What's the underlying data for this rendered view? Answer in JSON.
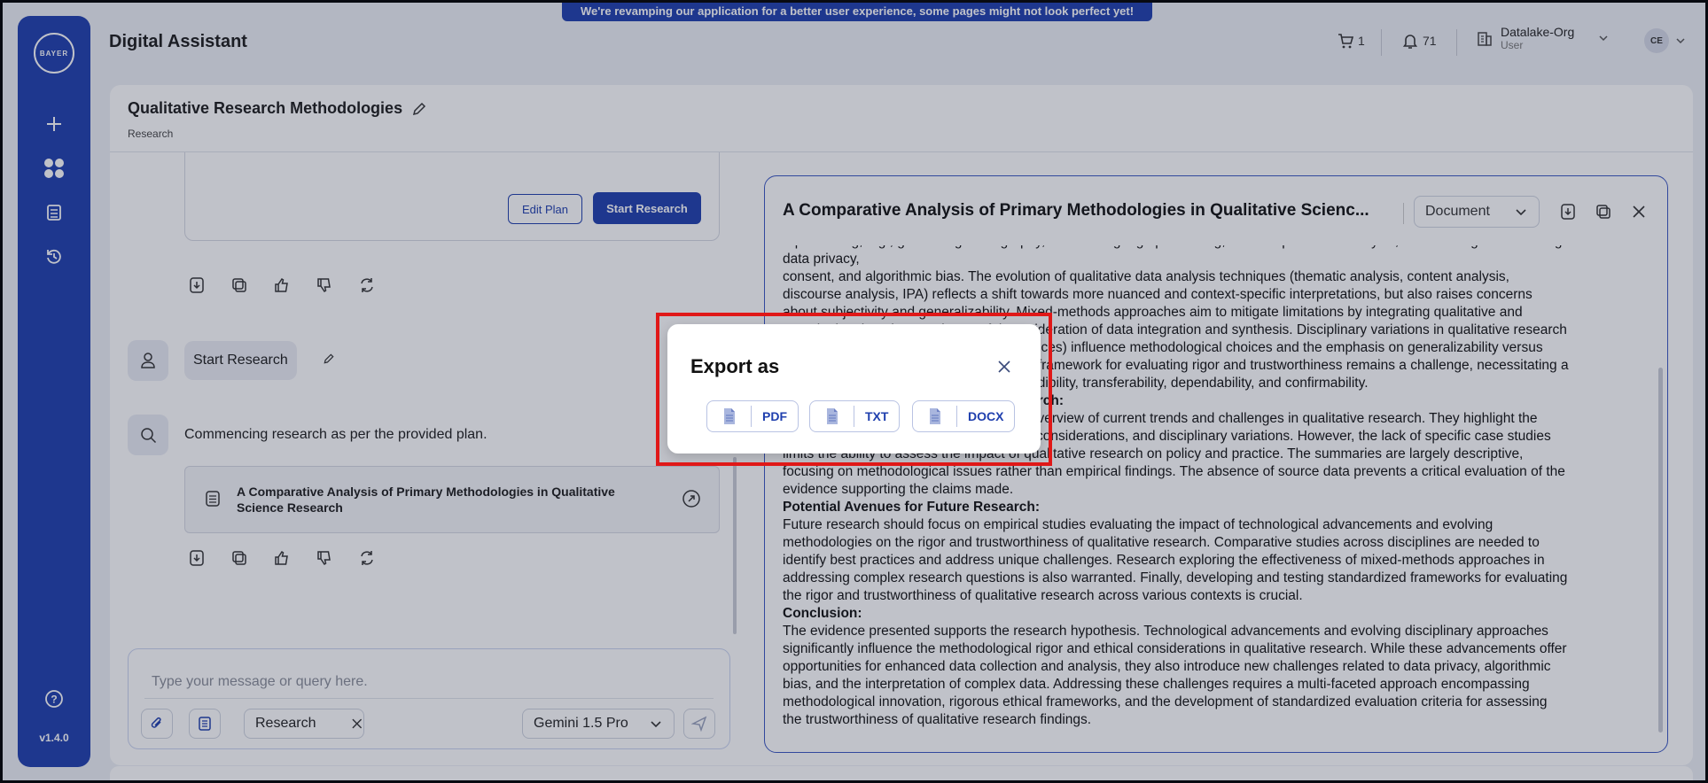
{
  "banner": {
    "text": "We're revamping our application for a better user experience, some pages might not look perfect yet!"
  },
  "sidebar": {
    "version": "v1.4.0",
    "logo_text": "BAYER"
  },
  "header": {
    "app_title": "Digital Assistant",
    "cart_count": "1",
    "notification_count": "71",
    "org_name": "Datalake-Org",
    "org_role": "User",
    "avatar_initials": "CE"
  },
  "project": {
    "title": "Qualitative Research Methodologies",
    "subtitle": "Research"
  },
  "chat": {
    "plan_buttons": {
      "edit": "Edit Plan",
      "start": "Start Research"
    },
    "user_message": "Start Research",
    "bot_message": "Commencing research as per the provided plan.",
    "doc_card_title": "A Comparative Analysis of Primary Methodologies in Qualitative Science Research"
  },
  "input": {
    "placeholder": "Type your message or query here.",
    "mode_chip": "Research",
    "model": "Gemini 1.5 Pro"
  },
  "panel": {
    "title": "A Comparative Analysis of Primary Methodologies in Qualitative Scienc...",
    "view_mode": "Document",
    "content": [
      {
        "type": "para",
        "text": "representing, e.g., generating ethnography, natural language processing, and computational analysis, while raising new challenges related to data privacy,"
      },
      {
        "type": "para",
        "text": "consent, and algorithmic bias. The evolution of qualitative data analysis techniques (thematic analysis, content analysis,"
      },
      {
        "type": "para",
        "text": "discourse analysis, IPA) reflects a shift towards more nuanced and context-specific interpretations, but also raises concerns"
      },
      {
        "type": "para",
        "text": "about subjectivity and generalizability. Mixed-methods approaches aim to mitigate limitations by integrating qualitative and"
      },
      {
        "type": "para",
        "text": "quantitative data, but require careful consideration of data integration and synthesis. Disciplinary variations in qualitative research"
      },
      {
        "type": "para",
        "text": "(e.g., sociology, anthropology, health sciences) influence methodological choices and the emphasis on generalizability versus"
      },
      {
        "type": "para",
        "text": "contextual understanding. A standardized framework for evaluating rigor and trustworthiness remains a challenge, necessitating a"
      },
      {
        "type": "para",
        "text": "multi-faceted approach encompassing credibility, transferability, dependability, and confirmability."
      },
      {
        "type": "heading",
        "text": "Critical Evaluation of Qualitative Research:"
      },
      {
        "type": "para",
        "text": "The provided summaries offer a general overview of current trends and challenges in qualitative research. They highlight the"
      },
      {
        "type": "para",
        "text": "impact of technological advances, ethical considerations, and disciplinary variations. However, the lack of specific case studies"
      },
      {
        "type": "para",
        "text": "limits the ability to assess the impact of qualitative research on policy and practice. The summaries are largely descriptive,"
      },
      {
        "type": "para",
        "text": "focusing on methodological issues rather than empirical findings. The absence of source data prevents a critical evaluation of the"
      },
      {
        "type": "para",
        "text": "evidence supporting the claims made."
      },
      {
        "type": "heading",
        "text": "Potential Avenues for Future Research:"
      },
      {
        "type": "para",
        "text": "Future research should focus on empirical studies evaluating the impact of technological advancements and evolving"
      },
      {
        "type": "para",
        "text": "methodologies on the rigor and trustworthiness of qualitative research. Comparative studies across disciplines are needed to"
      },
      {
        "type": "para",
        "text": "identify best practices and address unique challenges. Research exploring the effectiveness of mixed-methods approaches in"
      },
      {
        "type": "para",
        "text": "addressing complex research questions is also warranted. Finally, developing and testing standardized frameworks for evaluating"
      },
      {
        "type": "para",
        "text": "the rigor and trustworthiness of qualitative research across various contexts is crucial."
      },
      {
        "type": "heading",
        "text": "Conclusion:"
      },
      {
        "type": "para",
        "text": "The evidence presented supports the research hypothesis. Technological advancements and evolving disciplinary approaches"
      },
      {
        "type": "para",
        "text": "significantly influence the methodological rigor and ethical considerations in qualitative research. While these advancements offer"
      },
      {
        "type": "para",
        "text": "opportunities for enhanced data collection and analysis, they also introduce new challenges related to data privacy, algorithmic"
      },
      {
        "type": "para",
        "text": "bias, and the interpretation of complex data. Addressing these challenges requires a multi-faceted approach encompassing"
      },
      {
        "type": "para",
        "text": "methodological innovation, rigorous ethical frameworks, and the development of standardized evaluation criteria for assessing"
      },
      {
        "type": "para",
        "text": "the trustworthiness of qualitative research findings."
      }
    ]
  },
  "modal": {
    "title": "Export as",
    "options": [
      {
        "label": "PDF",
        "icon": "file-icon"
      },
      {
        "label": "TXT",
        "icon": "file-icon"
      },
      {
        "label": "DOCX",
        "icon": "file-icon"
      }
    ]
  },
  "colors": {
    "brand": "#1f3fae",
    "highlight": "#e01818"
  }
}
